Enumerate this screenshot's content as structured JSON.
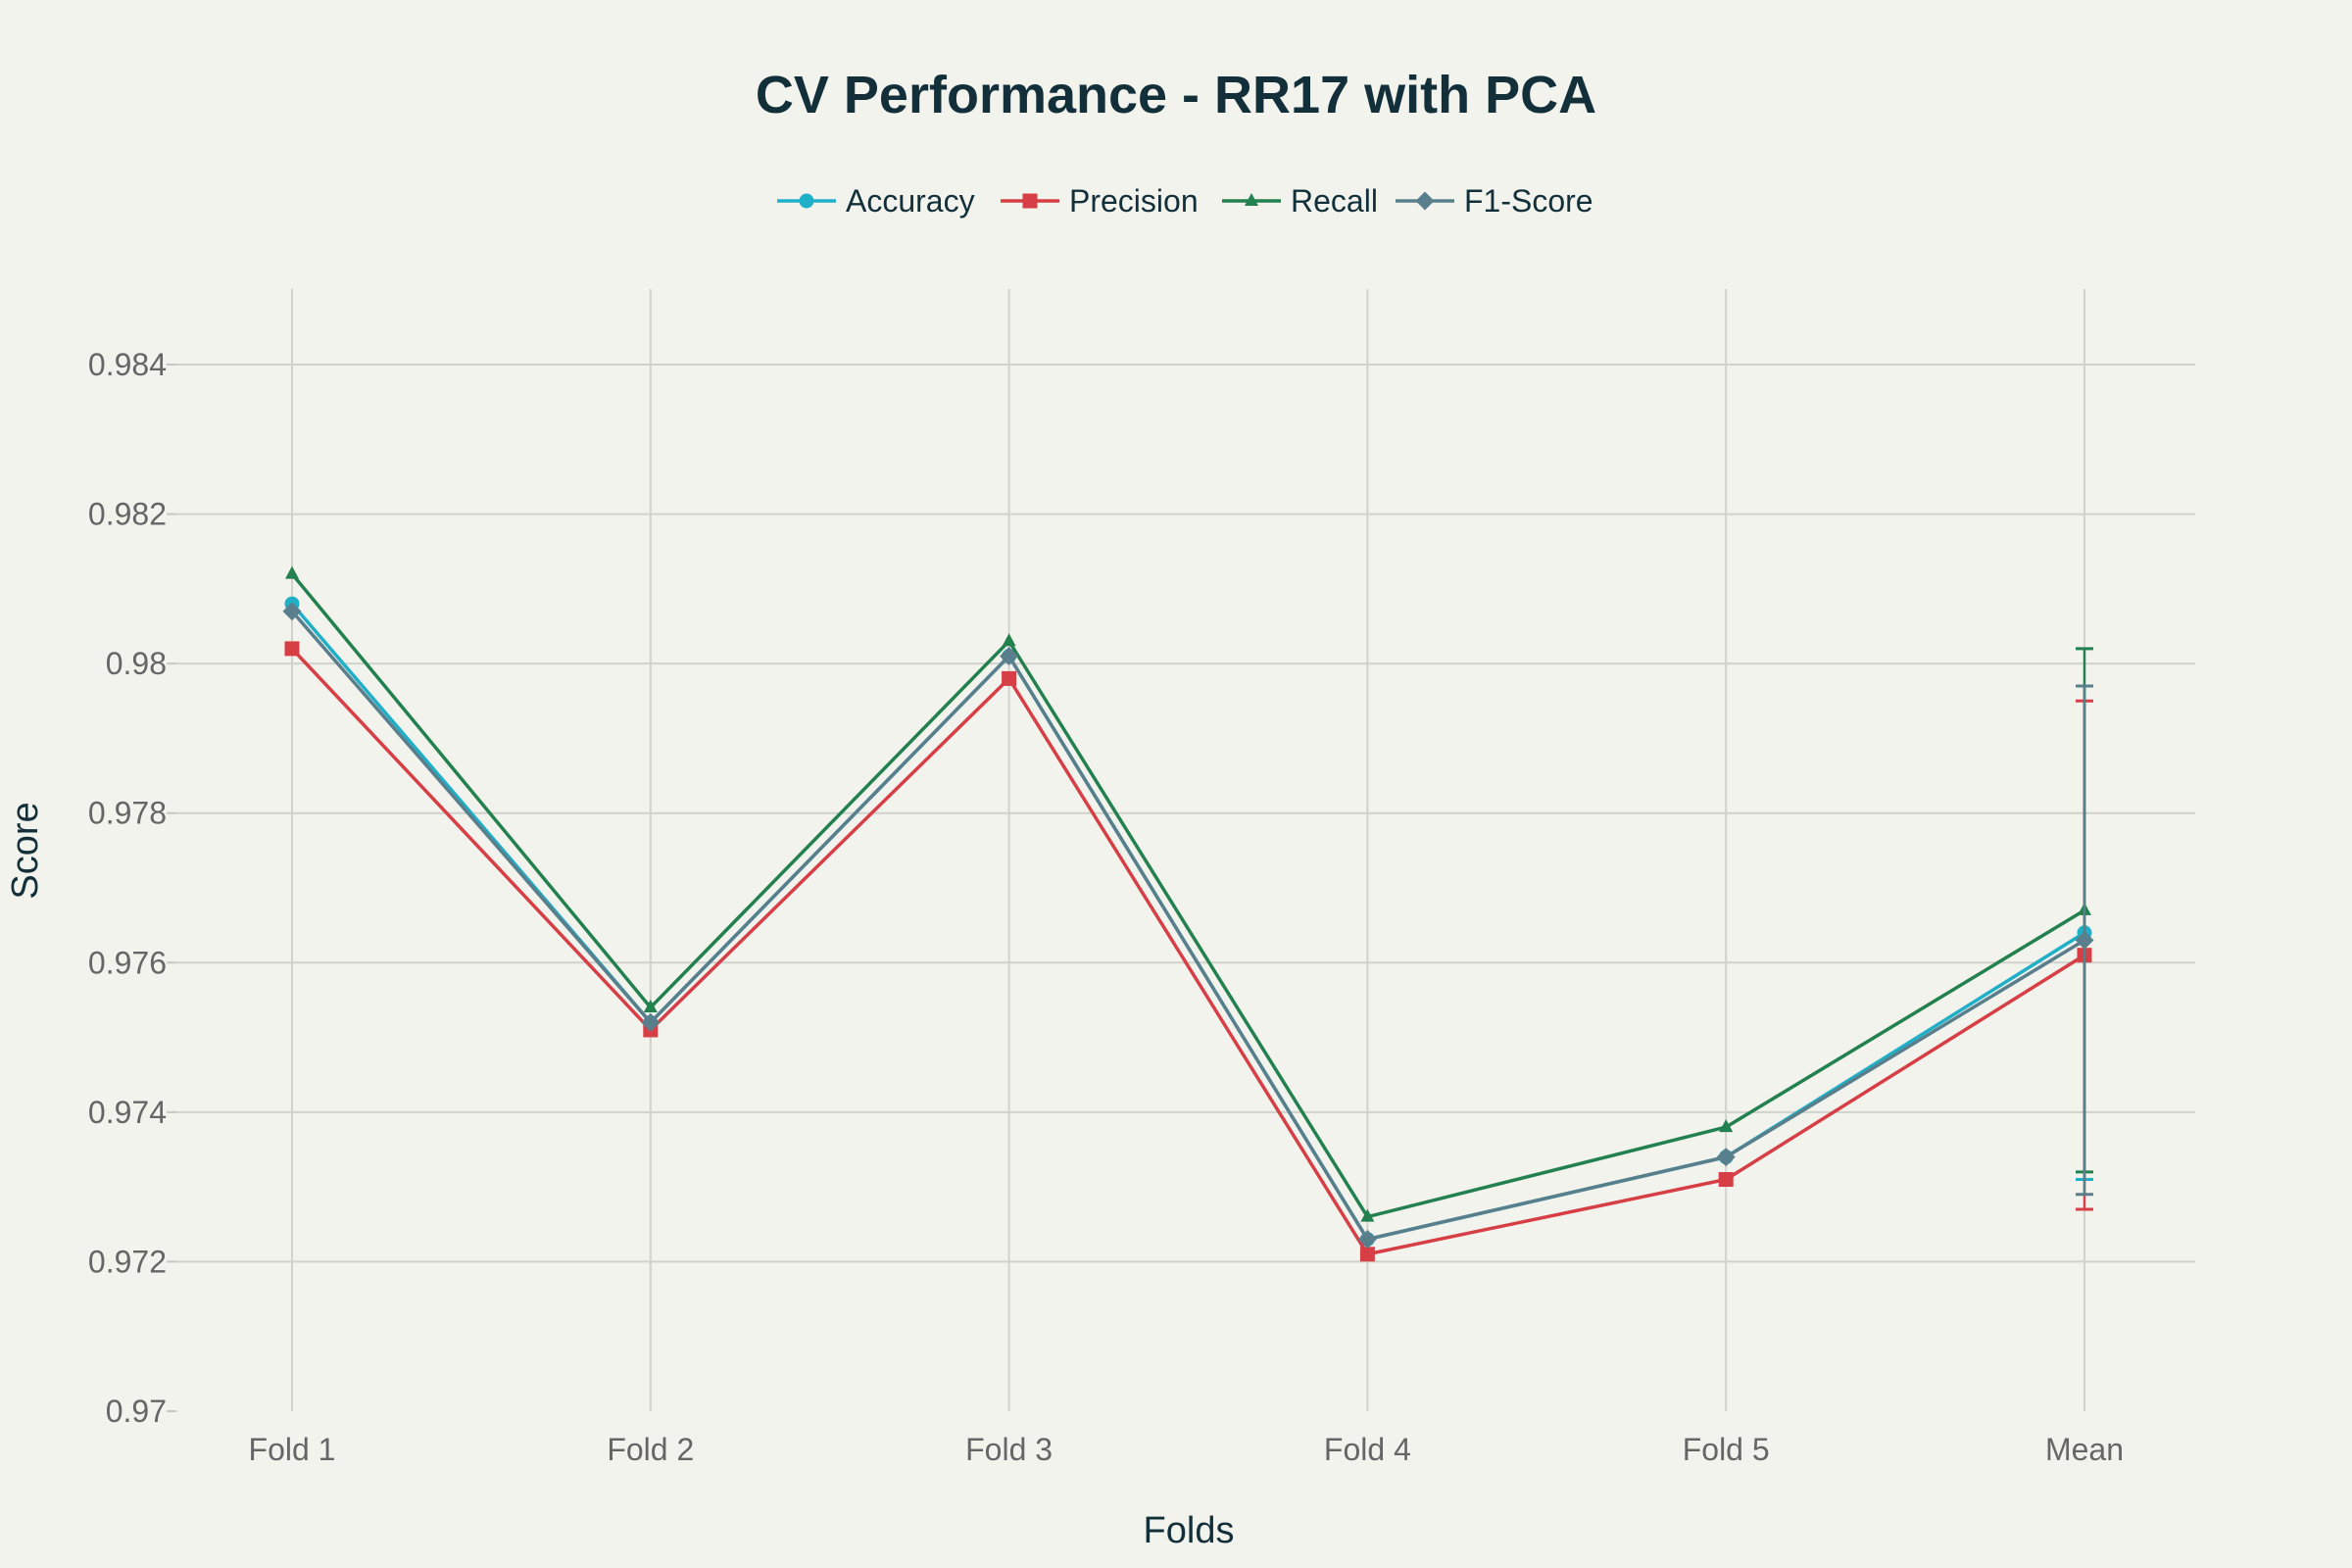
{
  "chart_data": {
    "type": "line",
    "title": "CV Performance - RR17 with PCA",
    "xlabel": "Folds",
    "ylabel": "Score",
    "categories": [
      "Fold 1",
      "Fold 2",
      "Fold 3",
      "Fold 4",
      "Fold 5",
      "Mean"
    ],
    "ylim": [
      0.97,
      0.985
    ],
    "yticks": [
      0.97,
      0.972,
      0.974,
      0.976,
      0.978,
      0.98,
      0.982,
      0.984
    ],
    "ytick_labels": [
      "0.97",
      "0.972",
      "0.974",
      "0.976",
      "0.978",
      "0.98",
      "0.982",
      "0.984"
    ],
    "grid": true,
    "legend_position": "top-center",
    "series": [
      {
        "name": "Accuracy",
        "color": "#1fb0c8",
        "marker": "circle",
        "values": [
          0.9808,
          0.9752,
          0.9801,
          0.9723,
          0.9734,
          0.9764
        ],
        "mean_error": [
          0.9731,
          0.9797
        ]
      },
      {
        "name": "Precision",
        "color": "#d63f45",
        "marker": "square",
        "values": [
          0.9802,
          0.9751,
          0.9798,
          0.9721,
          0.9731,
          0.9761
        ],
        "mean_error": [
          0.9727,
          0.9795
        ]
      },
      {
        "name": "Recall",
        "color": "#23804f",
        "marker": "triangle",
        "values": [
          0.9812,
          0.9754,
          0.9803,
          0.9726,
          0.9738,
          0.9767
        ],
        "mean_error": [
          0.9732,
          0.9802
        ]
      },
      {
        "name": "F1-Score",
        "color": "#5a7f8c",
        "marker": "diamond",
        "values": [
          0.9807,
          0.9752,
          0.9801,
          0.9723,
          0.9734,
          0.9763
        ],
        "mean_error": [
          0.9729,
          0.9797
        ]
      }
    ]
  }
}
